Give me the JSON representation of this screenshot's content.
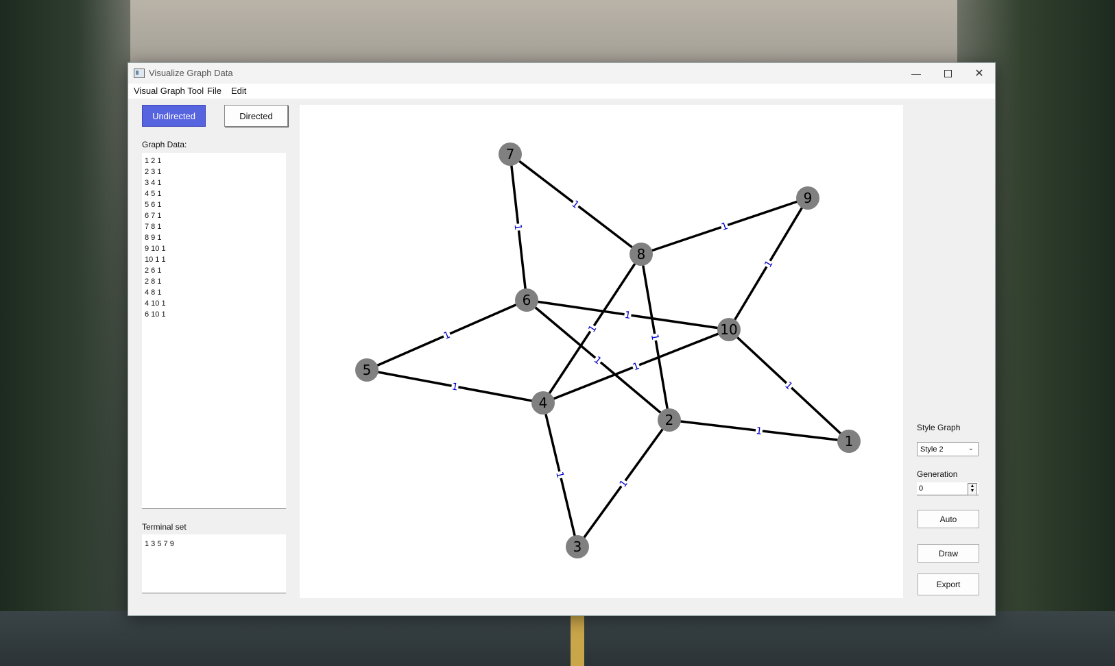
{
  "window": {
    "title": "Visualize Graph Data"
  },
  "menu": [
    "Visual Graph Tool",
    "File",
    "Edit"
  ],
  "mode": {
    "undirected_label": "Undirected",
    "directed_label": "Directed",
    "active": "undirected"
  },
  "graph_data": {
    "label": "Graph Data:",
    "lines": [
      "1 2 1",
      "2 3 1",
      "3 4 1",
      "4 5 1",
      "5 6 1",
      "6 7 1",
      "7 8 1",
      "8 9 1",
      "9 10 1",
      "10 1 1",
      "2 6 1",
      "2 8 1",
      "4 8 1",
      "4 10 1",
      "6 10 1"
    ]
  },
  "terminal_set": {
    "label": "Terminal set",
    "value": "1 3 5 7 9"
  },
  "style_graph": {
    "label": "Style Graph",
    "selected": "Style 2"
  },
  "generation": {
    "label": "Generation",
    "value": "0"
  },
  "buttons": {
    "auto": "Auto",
    "draw": "Draw",
    "export": "Export"
  },
  "graph": {
    "nodes": [
      "1",
      "2",
      "3",
      "4",
      "5",
      "6",
      "7",
      "8",
      "9",
      "10"
    ],
    "edges": [
      {
        "from": "1",
        "to": "2",
        "weight": "1"
      },
      {
        "from": "2",
        "to": "3",
        "weight": "1"
      },
      {
        "from": "3",
        "to": "4",
        "weight": "1"
      },
      {
        "from": "4",
        "to": "5",
        "weight": "1"
      },
      {
        "from": "5",
        "to": "6",
        "weight": "1"
      },
      {
        "from": "6",
        "to": "7",
        "weight": "1"
      },
      {
        "from": "7",
        "to": "8",
        "weight": "1"
      },
      {
        "from": "8",
        "to": "9",
        "weight": "1"
      },
      {
        "from": "9",
        "to": "10",
        "weight": "1"
      },
      {
        "from": "10",
        "to": "1",
        "weight": "1"
      },
      {
        "from": "2",
        "to": "6",
        "weight": "1"
      },
      {
        "from": "2",
        "to": "8",
        "weight": "1"
      },
      {
        "from": "4",
        "to": "8",
        "weight": "1"
      },
      {
        "from": "4",
        "to": "10",
        "weight": "1"
      },
      {
        "from": "6",
        "to": "10",
        "weight": "1"
      }
    ],
    "node_color": "#808080",
    "edge_color": "#000000",
    "weight_color": "#0000cc"
  }
}
